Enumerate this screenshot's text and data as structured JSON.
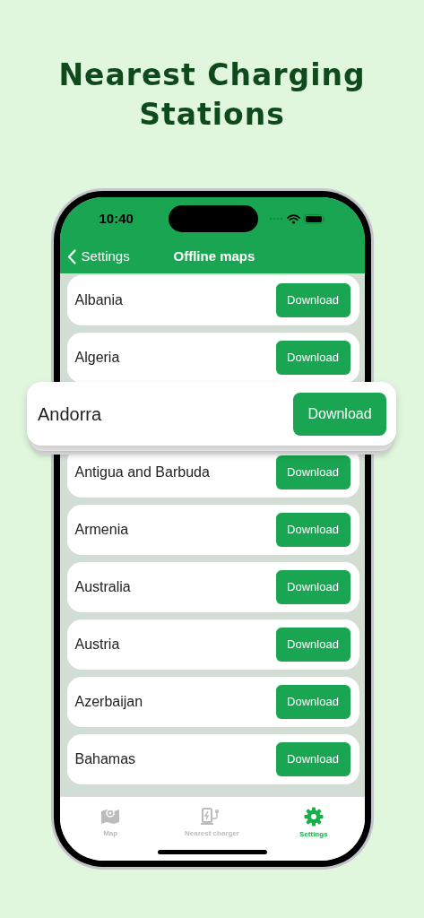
{
  "headline": "Nearest Charging Stations",
  "status_bar": {
    "time": "10:40"
  },
  "nav": {
    "back_label": "Settings",
    "title": "Offline maps"
  },
  "countries": [
    {
      "name": "Albania",
      "button": "Download",
      "kind": "row"
    },
    {
      "name": "Algeria",
      "button": "Download",
      "kind": "row"
    },
    {
      "name": "Andorra",
      "button": "Download",
      "kind": "lifted"
    },
    {
      "name": "Antigua and Barbuda",
      "button": "Download",
      "kind": "row"
    },
    {
      "name": "Armenia",
      "button": "Download",
      "kind": "row"
    },
    {
      "name": "Australia",
      "button": "Download",
      "kind": "row"
    },
    {
      "name": "Austria",
      "button": "Download",
      "kind": "row"
    },
    {
      "name": "Azerbaijan",
      "button": "Download",
      "kind": "row"
    },
    {
      "name": "Bahamas",
      "button": "Download",
      "kind": "row"
    }
  ],
  "tabs": [
    {
      "label": "Map",
      "kind": "map",
      "selected": false
    },
    {
      "label": "Nearest charger",
      "kind": "charger",
      "selected": false
    },
    {
      "label": "Settings",
      "kind": "settings",
      "selected": true
    }
  ]
}
